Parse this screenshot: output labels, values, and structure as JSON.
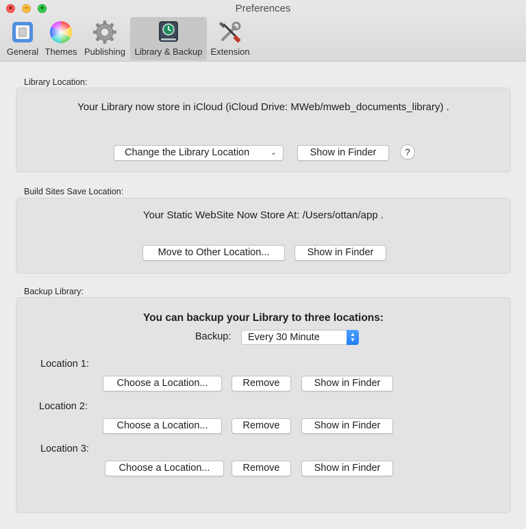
{
  "window": {
    "title": "Preferences",
    "buttons": {
      "close": "×",
      "minimize": "−",
      "maximize": "+"
    }
  },
  "toolbar": {
    "items": [
      {
        "label": "General",
        "icon": "switch-icon",
        "active": false
      },
      {
        "label": "Themes",
        "icon": "color-wheel-icon",
        "active": false
      },
      {
        "label": "Publishing",
        "icon": "gear-icon",
        "active": false
      },
      {
        "label": "Library & Backup",
        "icon": "time-machine-icon",
        "active": true
      },
      {
        "label": "Extension",
        "icon": "tools-icon",
        "active": false
      }
    ]
  },
  "library_location": {
    "title": "Library Location:",
    "message": "Your Library now store in iCloud (iCloud Drive: MWeb/mweb_documents_library) .",
    "change_button": "Change the Library Location",
    "show_button": "Show in Finder",
    "help": "?"
  },
  "build_sites": {
    "title": "Build Sites Save Location:",
    "message": "Your Static WebSite Now Store At: /Users/ottan/app .",
    "move_button": "Move to Other Location...",
    "show_button": "Show in Finder"
  },
  "backup": {
    "title": "Backup Library:",
    "headline": "You can backup your Library to three locations:",
    "frequency_label": "Backup:",
    "frequency_value": "Every 30 Minute",
    "locations": [
      {
        "label": "Location 1:",
        "choose": "Choose a Location...",
        "remove": "Remove",
        "show": "Show in Finder"
      },
      {
        "label": "Location 2:",
        "choose": "Choose a Location...",
        "remove": "Remove",
        "show": "Show in Finder"
      },
      {
        "label": "Location 3:",
        "choose": "Choose a Location...",
        "remove": "Remove",
        "show": "Show in Finder"
      }
    ]
  },
  "colors": {
    "accent": "#1f7cf3",
    "window_background": "#ececec",
    "group_background": "#e3e3e3"
  }
}
